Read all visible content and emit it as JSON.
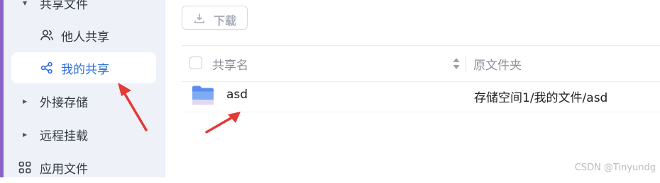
{
  "sidebar": {
    "shared_folder_label": "共享文件",
    "items": [
      {
        "label": "他人共享",
        "icon": "users-icon"
      },
      {
        "label": "我的共享",
        "icon": "share-icon"
      },
      {
        "label": "外接存储"
      },
      {
        "label": "远程挂载"
      },
      {
        "label": "应用文件",
        "icon": "apps-grid-icon"
      }
    ]
  },
  "toolbar": {
    "download_label": "下载",
    "download_icon": "download-icon"
  },
  "table": {
    "columns": [
      "共享名",
      "原文件夹"
    ],
    "rows": [
      {
        "name": "asd",
        "path": "存储空间1/我的文件/asd",
        "icon": "folder-icon"
      }
    ]
  },
  "watermark": "CSDN @Tinyundg",
  "colors": {
    "accent": "#2f6fdc",
    "sidebar_bg": "#eef1f7",
    "arrow": "#e53935",
    "folder": "#6b9cf2",
    "edge": "#8a63c9"
  }
}
